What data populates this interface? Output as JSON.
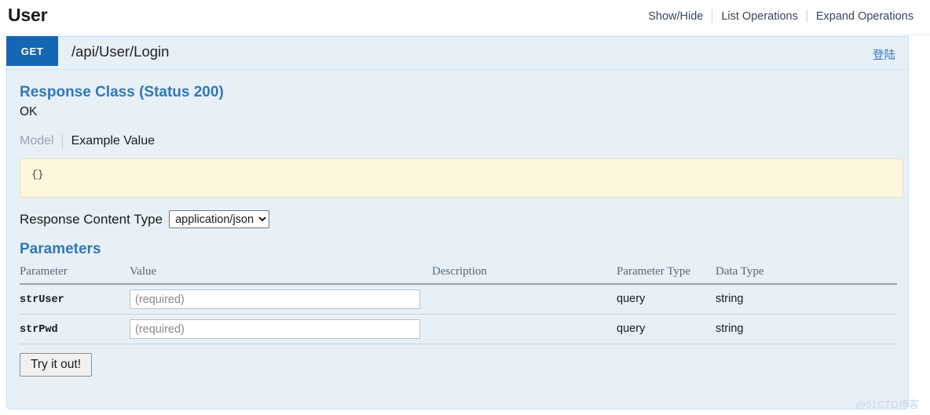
{
  "resource": {
    "title": "User",
    "options": [
      {
        "label": "Show/Hide"
      },
      {
        "label": "List Operations"
      },
      {
        "label": "Expand Operations"
      }
    ]
  },
  "operation": {
    "method": "GET",
    "path": "/api/User/Login",
    "summary": "登陆",
    "method_color": "#1567b3"
  },
  "response_class": {
    "heading": "Response Class (Status 200)",
    "description": "OK",
    "tabs": {
      "model": "Model",
      "example_value": "Example Value"
    },
    "example_code": "{}",
    "content_type": {
      "label": "Response Content Type",
      "selected": "application/json",
      "options": [
        "application/json"
      ]
    }
  },
  "parameters": {
    "heading": "Parameters",
    "columns": [
      "Parameter",
      "Value",
      "Description",
      "Parameter Type",
      "Data Type"
    ],
    "rows": [
      {
        "name": "strUser",
        "value": "",
        "placeholder": "(required)",
        "description": "",
        "parameter_type": "query",
        "data_type": "string"
      },
      {
        "name": "strPwd",
        "value": "",
        "placeholder": "(required)",
        "description": "",
        "parameter_type": "query",
        "data_type": "string"
      }
    ],
    "submit_label": "Try it out!"
  },
  "watermark": "@51CTO博客"
}
